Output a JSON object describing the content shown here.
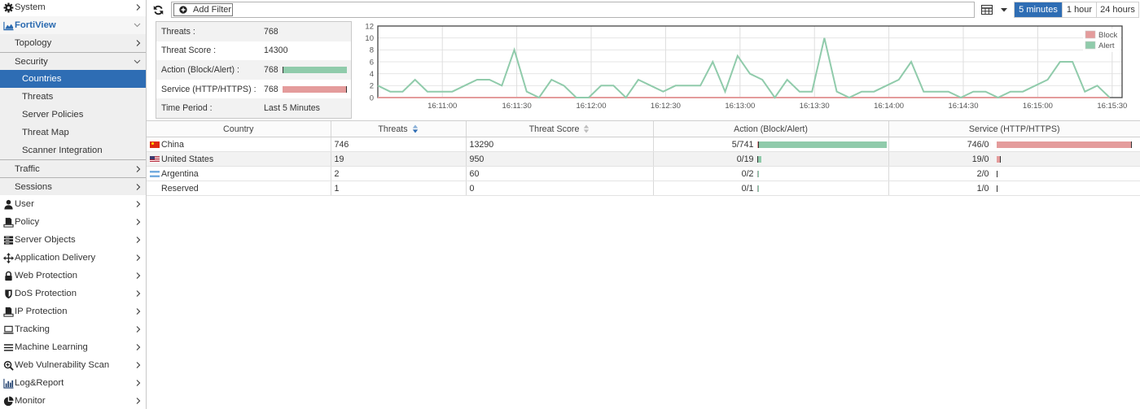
{
  "toolbar": {
    "refresh_icon": "refresh-icon",
    "add_filter_icon": "plus-circle-icon",
    "add_filter_label": "Add Filter",
    "view_icon": "table-view-icon",
    "time_ranges": [
      {
        "label": "5 minutes",
        "active": true
      },
      {
        "label": "1 hour",
        "active": false
      },
      {
        "label": "24 hours",
        "active": false
      }
    ]
  },
  "sidebar": {
    "items": [
      {
        "label": "System",
        "icon": "gear-icon",
        "level": 0,
        "chevron": "right"
      },
      {
        "label": "FortiView",
        "icon": "area-chart-icon",
        "level": 0,
        "chevron": "down",
        "expanded": true
      },
      {
        "label": "Topology",
        "level": 1,
        "chevron": "right"
      },
      {
        "label": "Security",
        "level": 1,
        "chevron": "down",
        "expanded": true
      },
      {
        "label": "Countries",
        "level": 2,
        "selected": true
      },
      {
        "label": "Threats",
        "level": 2
      },
      {
        "label": "Server Policies",
        "level": 2
      },
      {
        "label": "Threat Map",
        "level": 2
      },
      {
        "label": "Scanner Integration",
        "level": 2
      },
      {
        "label": "Traffic",
        "level": 1,
        "chevron": "right"
      },
      {
        "label": "Sessions",
        "level": 1,
        "chevron": "right"
      },
      {
        "label": "User",
        "icon": "user-icon",
        "level": 0,
        "chevron": "right"
      },
      {
        "label": "Policy",
        "icon": "policy-icon",
        "level": 0,
        "chevron": "right"
      },
      {
        "label": "Server Objects",
        "icon": "server-icon",
        "level": 0,
        "chevron": "right"
      },
      {
        "label": "Application Delivery",
        "icon": "move-arrows-icon",
        "level": 0,
        "chevron": "right"
      },
      {
        "label": "Web Protection",
        "icon": "lock-icon",
        "level": 0,
        "chevron": "right"
      },
      {
        "label": "DoS Protection",
        "icon": "shield-icon",
        "level": 0,
        "chevron": "right"
      },
      {
        "label": "IP Protection",
        "icon": "ip-protection-icon",
        "level": 0,
        "chevron": "right"
      },
      {
        "label": "Tracking",
        "icon": "laptop-icon",
        "level": 0,
        "chevron": "right"
      },
      {
        "label": "Machine Learning",
        "icon": "bars-icon",
        "level": 0,
        "chevron": "right"
      },
      {
        "label": "Web Vulnerability Scan",
        "icon": "search-plus-icon",
        "level": 0,
        "chevron": "right"
      },
      {
        "label": "Log&Report",
        "icon": "bar-chart-icon",
        "level": 0,
        "chevron": "right"
      },
      {
        "label": "Monitor",
        "icon": "pie-chart-icon",
        "level": 0,
        "chevron": "right"
      }
    ]
  },
  "summary": {
    "rows": [
      {
        "label": "Threats :",
        "value": "768"
      },
      {
        "label": "Threat Score :",
        "value": "14300"
      },
      {
        "label": "Action (Block/Alert) :",
        "value": "768",
        "bar": {
          "block": 5,
          "alert": 763
        }
      },
      {
        "label": "Service (HTTP/HTTPS) :",
        "value": "768",
        "bar": {
          "http": 768,
          "https": 0
        }
      },
      {
        "label": "Time Period :",
        "value": "Last 5 Minutes"
      }
    ]
  },
  "chart_data": {
    "type": "line",
    "title": "",
    "xlabel": "",
    "ylabel": "",
    "xlim": [
      "16:10:34",
      "16:15:34"
    ],
    "ylim": [
      0,
      12
    ],
    "x_ticks": [
      "16:11:00",
      "16:11:30",
      "16:12:00",
      "16:12:30",
      "16:13:00",
      "16:13:30",
      "16:14:00",
      "16:14:30",
      "16:15:00",
      "16:15:30"
    ],
    "y_ticks": [
      0,
      2,
      4,
      6,
      8,
      10,
      12
    ],
    "grid": true,
    "legend": "top-right",
    "x": [
      "16:10:34",
      "16:10:39",
      "16:10:44",
      "16:10:49",
      "16:10:54",
      "16:10:59",
      "16:11:04",
      "16:11:09",
      "16:11:14",
      "16:11:19",
      "16:11:24",
      "16:11:29",
      "16:11:34",
      "16:11:39",
      "16:11:44",
      "16:11:49",
      "16:11:54",
      "16:11:59",
      "16:12:04",
      "16:12:09",
      "16:12:14",
      "16:12:19",
      "16:12:24",
      "16:12:29",
      "16:12:34",
      "16:12:39",
      "16:12:44",
      "16:12:49",
      "16:12:54",
      "16:12:59",
      "16:13:04",
      "16:13:09",
      "16:13:14",
      "16:13:19",
      "16:13:24",
      "16:13:29",
      "16:13:34",
      "16:13:39",
      "16:13:44",
      "16:13:49",
      "16:13:54",
      "16:13:59",
      "16:14:04",
      "16:14:09",
      "16:14:14",
      "16:14:19",
      "16:14:24",
      "16:14:29",
      "16:14:34",
      "16:14:39",
      "16:14:44",
      "16:14:49",
      "16:14:54",
      "16:14:59",
      "16:15:04",
      "16:15:09",
      "16:15:14",
      "16:15:19",
      "16:15:24",
      "16:15:29"
    ],
    "series": [
      {
        "name": "Block",
        "color": "#e49c9c",
        "values": [
          0,
          0,
          0,
          0,
          0,
          0,
          0,
          0,
          0,
          0,
          0,
          0,
          0,
          0,
          0,
          0,
          0,
          0,
          0,
          0,
          0,
          0,
          0,
          0,
          0,
          0,
          0,
          0,
          0,
          0,
          0,
          0,
          0,
          0,
          0,
          0,
          0,
          0,
          0,
          0,
          0,
          0,
          0,
          0,
          0,
          0,
          0,
          0,
          0,
          0,
          0,
          0,
          0,
          0,
          0,
          0,
          0,
          0,
          0,
          0
        ]
      },
      {
        "name": "Alert",
        "color": "#90cbab",
        "values": [
          2,
          1,
          1,
          3,
          1,
          1,
          1,
          2,
          3,
          3,
          2,
          8,
          1,
          0,
          3,
          2,
          0,
          0,
          2,
          2,
          0,
          3,
          2,
          1,
          2,
          2,
          2,
          6,
          1,
          7,
          4,
          3,
          0,
          3,
          1,
          1,
          10,
          1,
          0,
          1,
          1,
          2,
          3,
          6,
          1,
          1,
          1,
          0,
          1,
          1,
          0,
          1,
          1,
          2,
          3,
          6,
          6,
          1,
          2,
          0
        ]
      }
    ]
  },
  "table": {
    "columns": [
      {
        "label": "Country",
        "sortable": false
      },
      {
        "label": "Threats",
        "sortable": true,
        "sort": "desc"
      },
      {
        "label": "Threat Score",
        "sortable": true,
        "sort": "none"
      },
      {
        "label": "Action (Block/Alert)",
        "sortable": false
      },
      {
        "label": "Service (HTTP/HTTPS)",
        "sortable": false
      }
    ],
    "rows": [
      {
        "country": "China",
        "flag": "cn",
        "threats": "746",
        "threat_score": "13290",
        "action": {
          "text": "5/741",
          "block": 5,
          "alert": 741
        },
        "service": {
          "text": "746/0",
          "http": 746,
          "https": 0
        }
      },
      {
        "country": "United States",
        "flag": "us",
        "threats": "19",
        "threat_score": "950",
        "action": {
          "text": "0/19",
          "block": 0,
          "alert": 19
        },
        "service": {
          "text": "19/0",
          "http": 19,
          "https": 0
        }
      },
      {
        "country": "Argentina",
        "flag": "ar",
        "threats": "2",
        "threat_score": "60",
        "action": {
          "text": "0/2",
          "block": 0,
          "alert": 2
        },
        "service": {
          "text": "2/0",
          "http": 2,
          "https": 0
        }
      },
      {
        "country": "Reserved",
        "flag": "",
        "threats": "1",
        "threat_score": "0",
        "action": {
          "text": "0/1",
          "block": 0,
          "alert": 1
        },
        "service": {
          "text": "1/0",
          "http": 1,
          "https": 0
        }
      }
    ]
  },
  "colors": {
    "accent": "#2e6db4",
    "fortiview_active_text": "#2a6ab0",
    "block": "#e49c9c",
    "alert": "#90cbab"
  }
}
